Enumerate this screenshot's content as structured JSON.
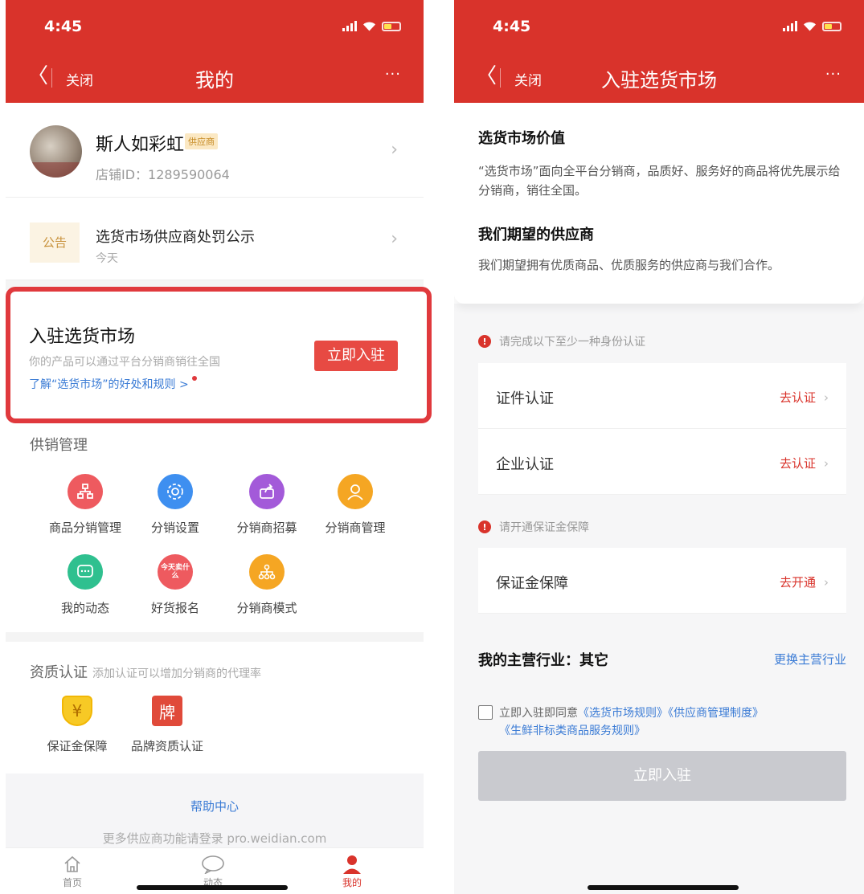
{
  "left": {
    "status": {
      "time": "4:45"
    },
    "nav": {
      "back": "〈",
      "close": "关闭",
      "title": "我的",
      "more": "···"
    },
    "profile": {
      "name": "斯人如彩虹",
      "tag": "供应商",
      "shop_id": "店铺ID：1289590064"
    },
    "notice": {
      "tag": "公告",
      "title": "选货市场供应商处罚公示",
      "date": "今天"
    },
    "join": {
      "title": "入驻选货市场",
      "subtitle": "你的产品可以通过平台分销商销往全国",
      "link": "了解“选货市场”的好处和规则 >",
      "button": "立即入驻"
    },
    "supply": {
      "title": "供销管理",
      "items": [
        {
          "label": "商品分销管理",
          "icon": "hierarchy-icon",
          "color": "#ee5a5f"
        },
        {
          "label": "分销设置",
          "icon": "gear-icon",
          "color": "#3e8ff0"
        },
        {
          "label": "分销商招募",
          "icon": "share-icon",
          "color": "#a35ad9"
        },
        {
          "label": "分销商管理",
          "icon": "users-icon",
          "color": "#f5a623"
        },
        {
          "label": "我的动态",
          "icon": "chat-icon",
          "color": "#2fc08f"
        },
        {
          "label": "好货报名",
          "icon": "today-icon",
          "icon_text": "今天卖什么",
          "color": "#ee5a5f"
        },
        {
          "label": "分销商模式",
          "icon": "network-icon",
          "color": "#f5a623"
        }
      ]
    },
    "qualification": {
      "title": "资质认证",
      "hint": "添加认证可以增加分销商的代理率",
      "items": [
        {
          "label": "保证金保障",
          "icon": "yen-shield-icon",
          "glyph": "¥",
          "color": "#f7c925"
        },
        {
          "label": "品牌资质认证",
          "icon": "brand-icon",
          "glyph": "牌",
          "color": "#e04a3a"
        }
      ]
    },
    "help": {
      "link": "帮助中心",
      "more": "更多供应商功能请登录 pro.weidian.com"
    },
    "tabbar": [
      {
        "label": "首页",
        "icon": "home-icon"
      },
      {
        "label": "动态",
        "icon": "chat-bubble-icon"
      },
      {
        "label": "我的",
        "icon": "person-icon"
      }
    ]
  },
  "right": {
    "status": {
      "time": "4:45"
    },
    "nav": {
      "back": "〈",
      "close": "关闭",
      "title": "入驻选货市场",
      "more": "···"
    },
    "value": {
      "heading": "选货市场价值",
      "text": "“选货市场”面向全平台分销商，品质好、服务好的商品将优先展示给分销商，销往全国。",
      "heading2": "我们期望的供应商",
      "text2": "我们期望拥有优质商品、优质服务的供应商与我们合作。"
    },
    "identity": {
      "warning": "请完成以下至少一种身份认证",
      "rows": [
        {
          "label": "证件认证",
          "action": "去认证"
        },
        {
          "label": "企业认证",
          "action": "去认证"
        }
      ]
    },
    "deposit": {
      "warning": "请开通保证金保障",
      "row": {
        "label": "保证金保障",
        "action": "去开通"
      }
    },
    "industry": {
      "label": "我的主营行业：其它",
      "change": "更换主营行业"
    },
    "agreement": {
      "prefix": "立即入驻即同意",
      "link1": "《选货市场规则》",
      "link2": "《供应商管理制度》",
      "link3": "《生鲜非标类商品服务规则》"
    },
    "submit": "立即入驻"
  }
}
